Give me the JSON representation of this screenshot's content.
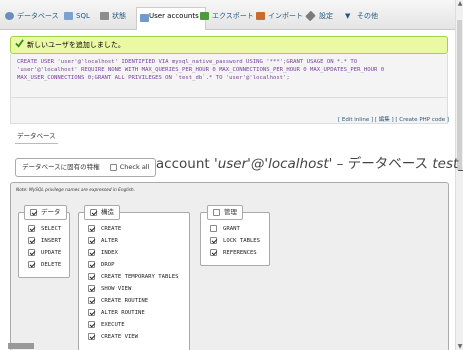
{
  "tabs": [
    {
      "label": "データベース",
      "icon_color": "#6b8fb8",
      "active": false
    },
    {
      "label": "SQL",
      "icon_color": "#7aa3cf",
      "active": false
    },
    {
      "label": "状態",
      "icon_color": "#8c8c8c",
      "active": false
    },
    {
      "label": "User accounts",
      "icon_color": "#6f9acb",
      "active": true
    },
    {
      "label": "エクスポート",
      "icon_color": "#4f9a3e",
      "active": false
    },
    {
      "label": "インポート",
      "icon_color": "#c96a2e",
      "active": false
    },
    {
      "label": "設定",
      "icon_color": "#7b7b7b",
      "active": false
    },
    {
      "label": "その他",
      "icon_color": "#555555",
      "active": false
    }
  ],
  "notice": {
    "text": "新しいユーザを追加しました。",
    "icon": "check-icon",
    "color": "#3a8a2a"
  },
  "sql": {
    "line1": "CREATE USER 'user'@'localhost' IDENTIFIED VIA mysql_native_password USING '***';GRANT USAGE ON *.* TO",
    "line2": "'user'@'localhost' REQUIRE NONE WITH MAX_QUERIES_PER_HOUR 0 MAX_CONNECTIONS_PER_HOUR 0 MAX_UPDATES_PER_HOUR 0",
    "line3": "MAX_USER_CONNECTIONS 0;GRANT ALL PRIVILEGES ON `test_db`.* TO 'user'@'localhost';",
    "links": "[ Edit inline ] [ 編集 ] [ Create PHP code ]"
  },
  "breadcrumb": "データベース",
  "title": {
    "prefix": "Edit privileges: User account ",
    "account": "'user'@'localhost'",
    "mid": " – データベース ",
    "db": "test_db"
  },
  "fieldset": {
    "legend": "データベースに固有の特権",
    "check_all": "Check all",
    "note": "Note: MySQL privilege names are expressed in English."
  },
  "groups": {
    "data": {
      "label": "データ",
      "items": [
        "SELECT",
        "INSERT",
        "UPDATE",
        "DELETE"
      ],
      "checked": [
        true,
        true,
        true,
        true
      ]
    },
    "structure": {
      "label": "構造",
      "items": [
        "CREATE",
        "ALTER",
        "INDEX",
        "DROP",
        "CREATE TEMPORARY TABLES",
        "SHOW VIEW",
        "CREATE ROUTINE",
        "ALTER ROUTINE",
        "EXECUTE",
        "CREATE VIEW"
      ],
      "checked": [
        true,
        true,
        true,
        true,
        true,
        true,
        true,
        true,
        true,
        true
      ]
    },
    "admin": {
      "label": "管理",
      "items": [
        "GRANT",
        "LOCK TABLES",
        "REFERENCES"
      ],
      "checked": [
        false,
        true,
        true
      ]
    }
  }
}
